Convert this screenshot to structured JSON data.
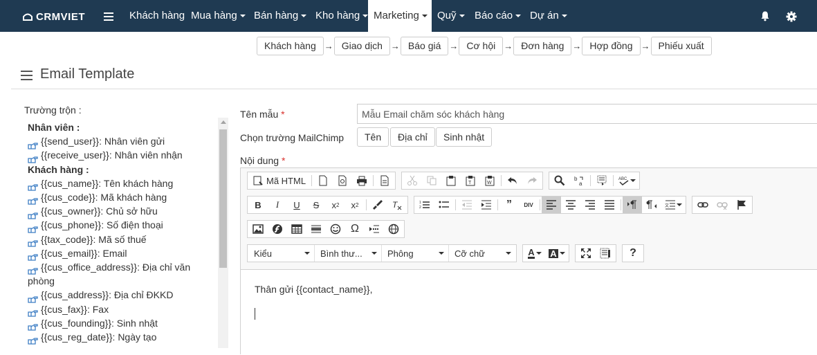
{
  "navbar": {
    "logo": "CRMVIET",
    "items": [
      {
        "label": "Khách hàng",
        "dropdown": false,
        "active": false
      },
      {
        "label": "Mua hàng",
        "dropdown": true,
        "active": false
      },
      {
        "label": "Bán hàng",
        "dropdown": true,
        "active": false
      },
      {
        "label": "Kho hàng",
        "dropdown": true,
        "active": false
      },
      {
        "label": "Marketing",
        "dropdown": true,
        "active": true
      },
      {
        "label": "Quỹ",
        "dropdown": true,
        "active": false
      },
      {
        "label": "Báo cáo",
        "dropdown": true,
        "active": false
      },
      {
        "label": "Dự án",
        "dropdown": true,
        "active": false
      }
    ],
    "icons": [
      "bell-icon",
      "gear-icon"
    ],
    "bg_color": "#1f3a52"
  },
  "flow": [
    "Khách hàng",
    "Giao dịch",
    "Báo giá",
    "Cơ hội",
    "Đơn hàng",
    "Hợp đồng",
    "Phiếu xuất"
  ],
  "page": {
    "title": "Email Template"
  },
  "merge": {
    "label": "Trường trộn :",
    "groups": [
      {
        "title": "Nhân viên :",
        "fields": [
          {
            "code": "{{send_user}}",
            "desc": ": Nhân viên gửi"
          },
          {
            "code": "{{receive_user}}",
            "desc": ": Nhân viên nhận"
          }
        ]
      },
      {
        "title": "Khách hàng :",
        "fields": [
          {
            "code": "{{cus_name}}",
            "desc": ": Tên khách hàng"
          },
          {
            "code": "{{cus_code}}",
            "desc": ": Mã khách hàng"
          },
          {
            "code": "{{cus_owner}}",
            "desc": ": Chủ sở hữu"
          },
          {
            "code": "{{cus_phone}}",
            "desc": ": Số điện thoại"
          },
          {
            "code": "{{tax_code}}",
            "desc": ": Mã số thuế"
          },
          {
            "code": "{{cus_email}}",
            "desc": ": Email"
          },
          {
            "code": "{{cus_office_address}}",
            "desc": ": Địa chỉ văn phòng"
          },
          {
            "code": "{{cus_address}}",
            "desc": ": Địa chỉ ĐKKD"
          },
          {
            "code": "{{cus_fax}}",
            "desc": ": Fax"
          },
          {
            "code": "{{cus_founding}}",
            "desc": ": Sinh nhật"
          },
          {
            "code": "{{cus_reg_date}}",
            "desc": ": Ngày tạo"
          }
        ]
      }
    ]
  },
  "form": {
    "template_name_label": "Tên mẫu",
    "template_name_value": "Mẫu Email chăm sóc khách hàng",
    "mailchimp_label": "Chọn trường MailChimp",
    "mailchimp_buttons": [
      "Tên",
      "Địa chỉ",
      "Sinh nhật"
    ],
    "content_label": "Nội dung",
    "required_mark": "*"
  },
  "editor": {
    "source_label": "Mã HTML",
    "combos": [
      "Kiểu",
      "Bình thư...",
      "Phông",
      "Cỡ chữ"
    ],
    "body_text": "Thân gửi  {{contact_name}},"
  }
}
